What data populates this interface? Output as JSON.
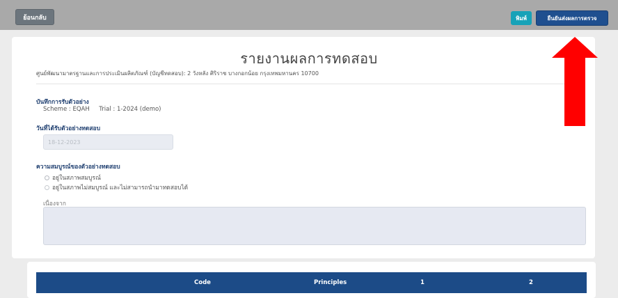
{
  "toolbar": {
    "back_label": "ย้อนกลับ",
    "print_label": "พิมพ์",
    "confirm_label": "ยืนยันส่งผลการตรวจ"
  },
  "report": {
    "title": "รายงานผลการทดสอบ",
    "subtitle": "ศูนย์พัฒนามาตรฐานและการประเมินผลิตภัณฑ์ (บัญชีทดสอบ): 2 วังหลัง ศิริราช บางกอกน้อย กรุงเทพมหานคร 10700"
  },
  "sample_record": {
    "heading": "บันทึกการรับตัวอย่าง",
    "scheme_label": "Scheme",
    "scheme_value": "EQAH",
    "trial_label": "Trial",
    "trial_value": "1-2024 (demo)"
  },
  "received_date": {
    "heading": "วันที่ได้รับตัวอย่างทดสอบ",
    "value": "18-12-2023"
  },
  "integrity": {
    "heading": "ความสมบูรณ์ของตัวอย่างทดสอบ",
    "options": [
      "อยู่ในสภาพสมบูรณ์",
      "อยู่ในสภาพไม่สมบูรณ์ และไม่สามารถนำมาทดสอบได้"
    ],
    "selected_index": 0,
    "reason_label": "เนื่องจาก",
    "reason_value": ""
  },
  "table": {
    "headers": [
      "Code",
      "Principles",
      "1",
      "2"
    ]
  },
  "colors": {
    "topbar": "#a9a9a9",
    "confirm_button": "#1f4f8f",
    "print_button": "#17a2b8",
    "table_header": "#1c4b87",
    "annotation_arrow": "#ff0000"
  },
  "annotation": {
    "icon": "up-arrow-icon"
  }
}
